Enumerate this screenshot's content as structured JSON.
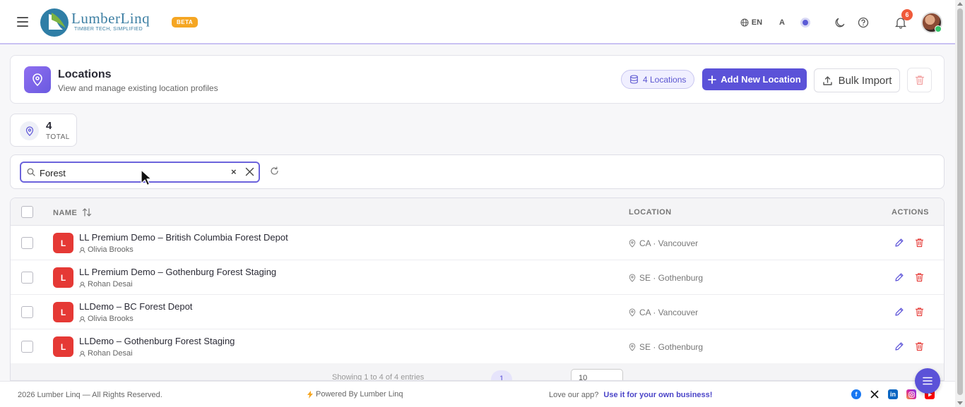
{
  "header": {
    "logo_name": "LumberLinq",
    "logo_tagline": "TIMBER TECH, SIMPLIFIED",
    "beta_label": "BETA",
    "language": "EN",
    "font_size_label": "A",
    "notification_count": "6",
    "accent_color": "#5b52d8"
  },
  "page": {
    "title": "Locations",
    "subtitle": "View and manage existing location profiles",
    "count_pill": "4 Locations",
    "add_button": "Add New Location",
    "bulk_button": "Bulk Import"
  },
  "stat": {
    "value": "4",
    "label": "TOTAL"
  },
  "search": {
    "value": "Forest",
    "placeholder": ""
  },
  "table": {
    "columns": {
      "name": "NAME",
      "location": "LOCATION",
      "actions": "ACTIONS"
    },
    "rows": [
      {
        "initial": "L",
        "name": "LL Premium Demo – British Columbia Forest Depot",
        "owner": "Olivia Brooks",
        "location": "CA · Vancouver"
      },
      {
        "initial": "L",
        "name": "LL Premium Demo – Gothenburg Forest Staging",
        "owner": "Rohan Desai",
        "location": "SE · Gothenburg"
      },
      {
        "initial": "L",
        "name": "LLDemo – BC Forest Depot",
        "owner": "Olivia Brooks",
        "location": "CA · Vancouver"
      },
      {
        "initial": "L",
        "name": "LLDemo – Gothenburg Forest Staging",
        "owner": "Rohan Desai",
        "location": "SE · Gothenburg"
      }
    ],
    "pagination": {
      "summary": "Showing 1 to 4 of 4 entries",
      "current_page": "1",
      "page_size": "10"
    }
  },
  "footer": {
    "copyright": "2026 Lumber Linq — All Rights Reserved.",
    "powered": "Powered By Lumber Linq",
    "love_text": "Love our app?",
    "love_link": "Use it for your own business!"
  }
}
